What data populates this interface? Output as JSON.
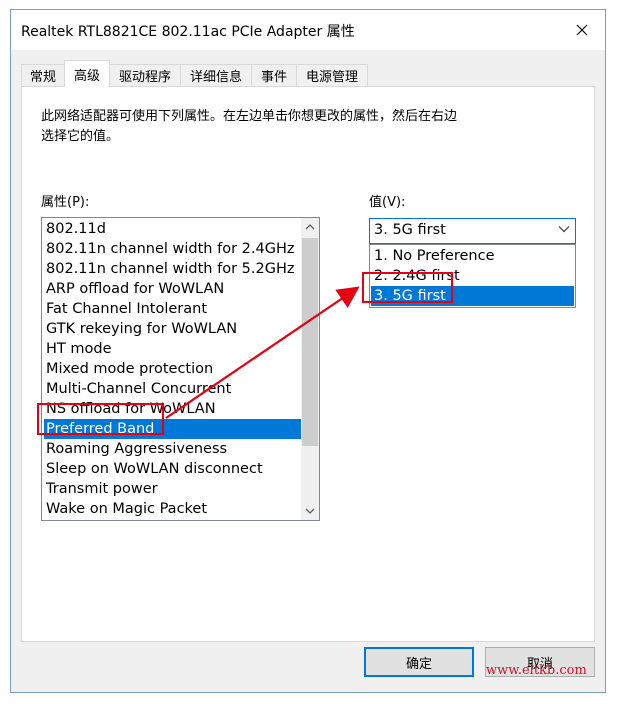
{
  "window": {
    "title": "Realtek RTL8821CE 802.11ac PCIe Adapter 属性"
  },
  "tabs": [
    {
      "label": "常规"
    },
    {
      "label": "高级"
    },
    {
      "label": "驱动程序"
    },
    {
      "label": "详细信息"
    },
    {
      "label": "事件"
    },
    {
      "label": "电源管理"
    }
  ],
  "panel": {
    "description_line1": "此网络适配器可使用下列属性。在左边单击你想更改的属性，然后在右边",
    "description_line2": "选择它的值。",
    "property_label": "属性(P):",
    "value_label": "值(V):",
    "properties": [
      "802.11d",
      "802.11n channel width for 2.4GHz",
      "802.11n channel width for 5.2GHz",
      "ARP offload for WoWLAN",
      "Fat Channel Intolerant",
      "GTK rekeying for WoWLAN",
      "HT mode",
      "Mixed mode protection",
      "Multi-Channel Concurrent",
      "NS offload for WoWLAN",
      "Preferred Band",
      "Roaming Aggressiveness",
      "Sleep on WoWLAN disconnect",
      "Transmit power",
      "Wake on Magic Packet"
    ],
    "selected_property": "Preferred Band",
    "value_selected": "3. 5G first",
    "value_options": [
      "1. No Preference",
      "2. 2.4G first",
      "3. 5G first"
    ]
  },
  "buttons": {
    "ok": "确定",
    "cancel": "取消"
  },
  "watermark": "www.eltkb.com",
  "colors": {
    "selection": "#0078d7",
    "annotation": "#e60012"
  }
}
